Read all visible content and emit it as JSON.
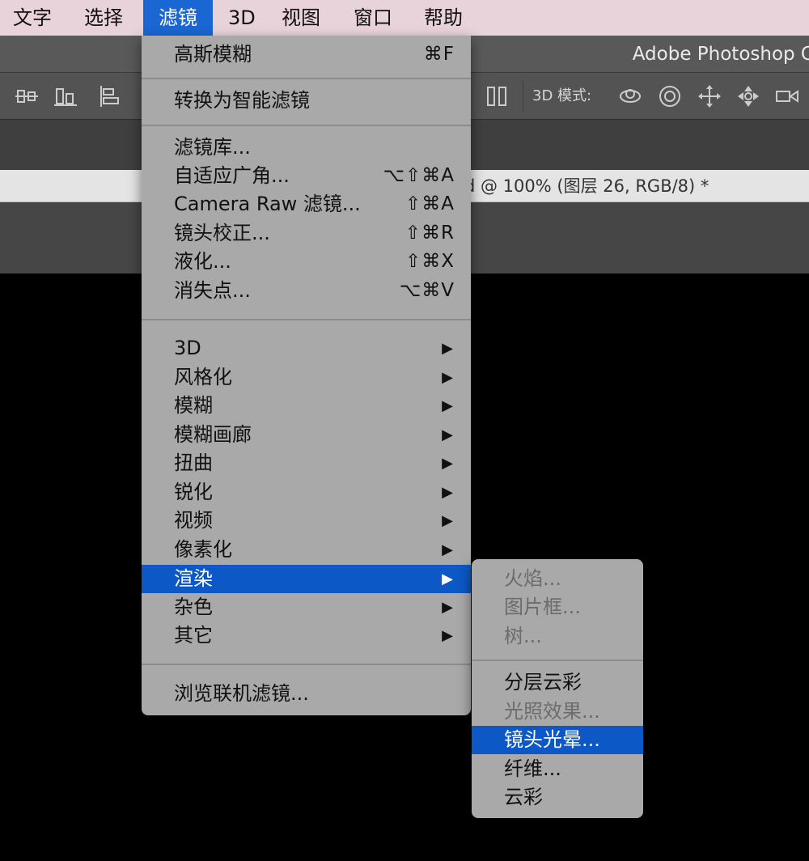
{
  "menubar": {
    "items": [
      {
        "label": "文字"
      },
      {
        "label": "选择"
      },
      {
        "label": "滤镜"
      },
      {
        "label": "3D"
      },
      {
        "label": "视图"
      },
      {
        "label": "窗口"
      },
      {
        "label": "帮助"
      }
    ],
    "active_index": 2
  },
  "window": {
    "title": "Adobe Photoshop C"
  },
  "options_bar": {
    "mode_label": "3D 模式:"
  },
  "document": {
    "tab_title": "d @ 100% (图层 26, RGB/8) *"
  },
  "filter_menu": {
    "items": [
      {
        "label": "高斯模糊",
        "shortcut": "⌘F"
      },
      {
        "label": "转换为智能滤镜"
      },
      {
        "label": "滤镜库..."
      },
      {
        "label": "自适应广角...",
        "shortcut": "⌥⇧⌘A"
      },
      {
        "label": "Camera Raw 滤镜...",
        "shortcut": "⇧⌘A"
      },
      {
        "label": "镜头校正...",
        "shortcut": "⇧⌘R"
      },
      {
        "label": "液化...",
        "shortcut": "⇧⌘X"
      },
      {
        "label": "消失点...",
        "shortcut": "⌥⌘V"
      },
      {
        "label": "3D",
        "submenu": true
      },
      {
        "label": "风格化",
        "submenu": true
      },
      {
        "label": "模糊",
        "submenu": true
      },
      {
        "label": "模糊画廊",
        "submenu": true
      },
      {
        "label": "扭曲",
        "submenu": true
      },
      {
        "label": "锐化",
        "submenu": true
      },
      {
        "label": "视频",
        "submenu": true
      },
      {
        "label": "像素化",
        "submenu": true
      },
      {
        "label": "渲染",
        "submenu": true,
        "highlighted": true
      },
      {
        "label": "杂色",
        "submenu": true
      },
      {
        "label": "其它",
        "submenu": true
      },
      {
        "label": "浏览联机滤镜..."
      }
    ],
    "submenu_arrow": "▶"
  },
  "render_submenu": {
    "items": [
      {
        "label": "火焰...",
        "disabled": true
      },
      {
        "label": "图片框...",
        "disabled": true
      },
      {
        "label": "树...",
        "disabled": true
      },
      {
        "label": "分层云彩"
      },
      {
        "label": "光照效果...",
        "disabled": true
      },
      {
        "label": "镜头光晕...",
        "highlighted": true
      },
      {
        "label": "纤维..."
      },
      {
        "label": "云彩"
      }
    ]
  },
  "colors": {
    "highlight": "#0c58c6",
    "menubar_bg": "#e8d3da",
    "menu_bg": "#a9a9a9"
  }
}
